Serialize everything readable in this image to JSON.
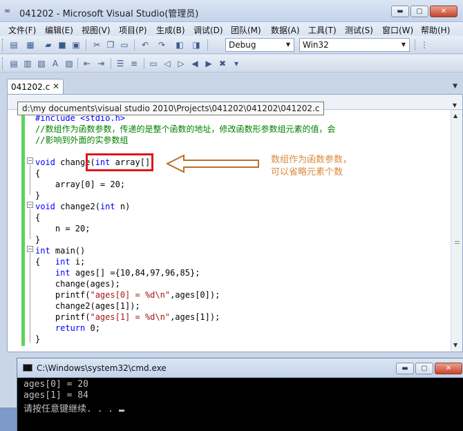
{
  "window": {
    "logo": "∞",
    "title": "041202 - Microsoft Visual Studio(管理员)",
    "buttons": {
      "minimize": "▬",
      "maximize": "▢",
      "close": "✕"
    }
  },
  "menu": [
    "文件(F)",
    "编辑(E)",
    "视图(V)",
    "项目(P)",
    "生成(B)",
    "调试(D)",
    "团队(M)",
    "数据(A)",
    "工具(T)",
    "测试(S)",
    "窗口(W)",
    "帮助(H)"
  ],
  "toolbar": {
    "config": "Debug",
    "platform": "Win32"
  },
  "tab": {
    "label": "041202.c",
    "close": "✕"
  },
  "path_tooltip": "d:\\my documents\\visual studio 2010\\Projects\\041202\\041202\\041202.c",
  "code": {
    "line0": "#include <stdio.h>",
    "line1": "//数组作为函数参数，传递的是整个函数的地址，修改函数形参数组元素的值，会",
    "line2": "//影响到外面的实参数组",
    "l4_kw": "void",
    "l4_rest": " change(",
    "l4_kw2": "int",
    "l4_tail": " array[])",
    "brace_open": "{",
    "l6": "    array[0] = 20;",
    "brace_close": "}",
    "l8_kw": "void",
    "l8_rest": " change2(",
    "l8_kw2": "int",
    "l8_tail": " n)",
    "l10": "    n = 20;",
    "l12_kw": "int",
    "l12_rest": " main()",
    "l13_pre": "{   ",
    "l13_kw": "int",
    "l13_rest": " i;",
    "l14_pre": "    ",
    "l14_kw": "int",
    "l14_rest": " ages[] ={10,84,97,96,85};",
    "l15": "    change(ages);",
    "l16_pre": "    printf(",
    "l16_str": "\"ages[0] = %d\\n\"",
    "l16_post": ",ages[0]);",
    "l17": "    change2(ages[1]);",
    "l18_pre": "    printf(",
    "l18_str": "\"ages[1] = %d\\n\"",
    "l18_post": ",ages[1]);",
    "l19_pre": "    ",
    "l19_kw": "return",
    "l19_rest": " 0;"
  },
  "annotation": {
    "line1": "数组作为函数参数，",
    "line2": "可以省略元素个数",
    "color": "#d98a3a",
    "highlight_color": "#e2141c"
  },
  "console": {
    "title": "C:\\Windows\\system32\\cmd.exe",
    "output": [
      "ages[0] = 20",
      "ages[1] = 84",
      "请按任意键继续. . . "
    ]
  }
}
